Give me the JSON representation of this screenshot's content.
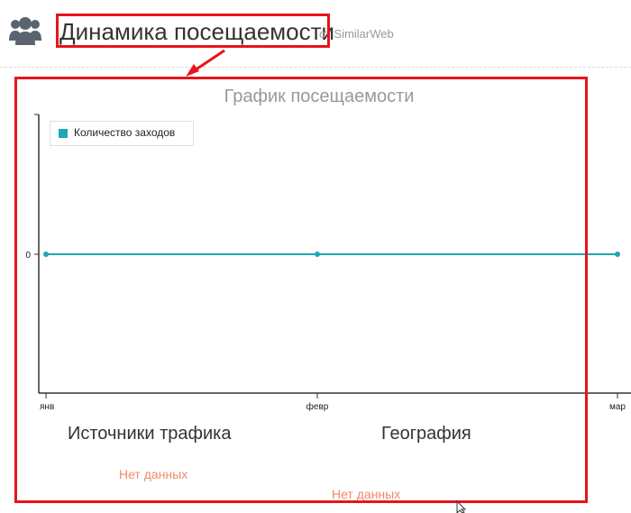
{
  "header": {
    "title": "Динамика посещаемости",
    "source": "от SimilarWeb",
    "icon": "users-group-icon"
  },
  "chart": {
    "title": "График посещаемости",
    "legend_label": "Количество заходов",
    "series_color": "#1fa6b3"
  },
  "chart_data": {
    "type": "line",
    "title": "График посещаемости",
    "xlabel": "",
    "ylabel": "",
    "categories": [
      "янв",
      "февр",
      "мар"
    ],
    "series": [
      {
        "name": "Количество заходов",
        "values": [
          0,
          0,
          0
        ]
      }
    ],
    "y_ticks": [
      "0"
    ],
    "legend": "top-left",
    "grid": false
  },
  "sections": {
    "traffic_sources": {
      "title": "Источники трафика",
      "empty": "Нет данных"
    },
    "geography": {
      "title": "География",
      "empty": "Нет данных"
    }
  },
  "colors": {
    "annotation": "#e8141c",
    "no_data": "#f08a6c"
  }
}
